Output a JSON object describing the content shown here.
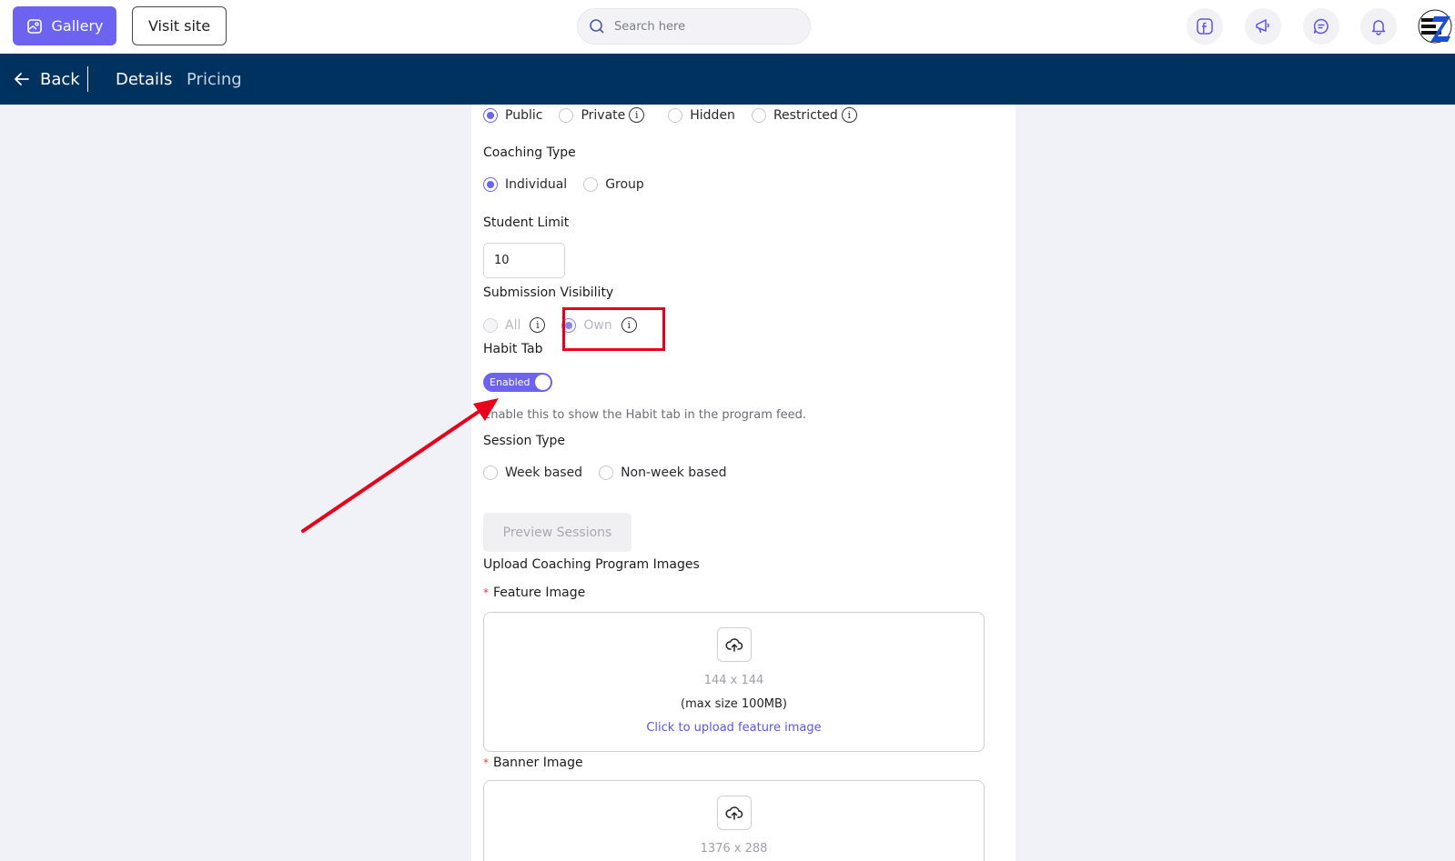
{
  "topbar": {
    "gallery_label": "Gallery",
    "visit_site_label": "Visit site",
    "search_placeholder": "Search here"
  },
  "navbar": {
    "back_label": "Back",
    "tabs": [
      {
        "label": "Details"
      },
      {
        "label": "Pricing"
      }
    ]
  },
  "form": {
    "visibility_options": [
      {
        "label": "Public",
        "checked": true
      },
      {
        "label": "Private"
      },
      {
        "label": "Hidden"
      },
      {
        "label": "Restricted"
      }
    ],
    "coaching_type": {
      "label": "Coaching Type",
      "options": [
        {
          "label": "Individual",
          "checked": true
        },
        {
          "label": "Group"
        }
      ]
    },
    "student_limit": {
      "label": "Student Limit",
      "value": "10"
    },
    "submission_visibility": {
      "label": "Submission Visibility",
      "options": [
        {
          "label": "All"
        },
        {
          "label": "Own",
          "checked": true
        }
      ]
    },
    "habit_tab": {
      "label": "Habit Tab",
      "toggle_label": "Enabled",
      "help": "Enable this to show the Habit tab in the program feed."
    },
    "session_type": {
      "label": "Session Type",
      "options": [
        {
          "label": "Week based"
        },
        {
          "label": "Non-week based"
        }
      ]
    },
    "preview_sessions_label": "Preview Sessions",
    "upload": {
      "section_label": "Upload Coaching Program Images",
      "required_mark": "*",
      "feature": {
        "label": "Feature Image",
        "dimensions": "144 x 144",
        "max_size": "(max size 100MB)",
        "link": "Click to upload feature image"
      },
      "banner": {
        "label": "Banner Image",
        "dimensions": "1376 x 288"
      }
    }
  },
  "colors": {
    "accent": "#6c63f0",
    "navbar": "#00325f",
    "annotation": "#e8001a"
  }
}
